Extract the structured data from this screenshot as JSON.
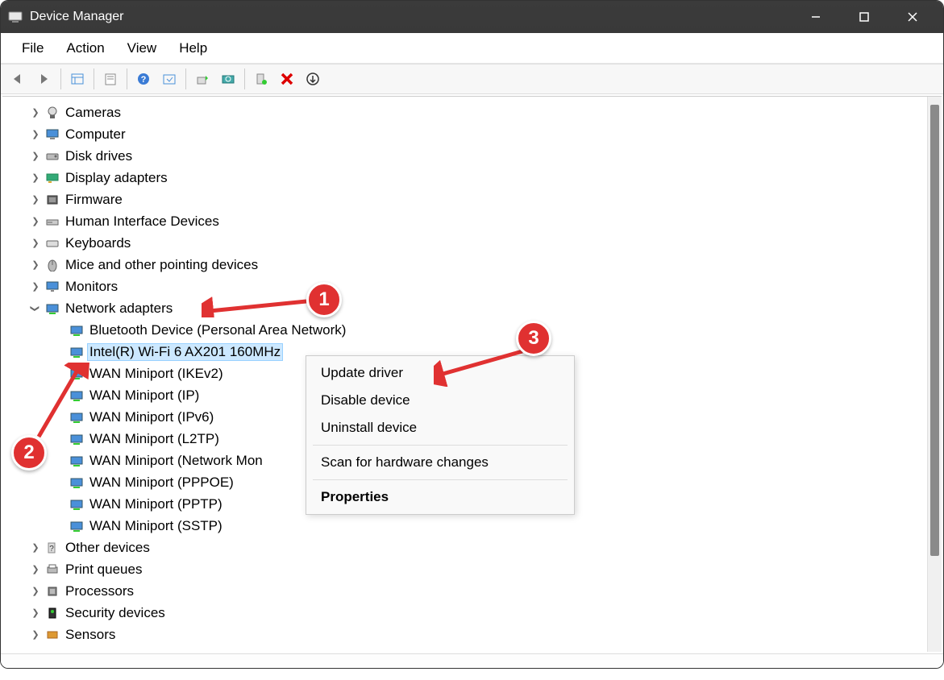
{
  "window": {
    "title": "Device Manager"
  },
  "menubar": {
    "file": "File",
    "action": "Action",
    "view": "View",
    "help": "Help"
  },
  "tree": {
    "cameras": "Cameras",
    "computer": "Computer",
    "disk_drives": "Disk drives",
    "display_adapters": "Display adapters",
    "firmware": "Firmware",
    "hid": "Human Interface Devices",
    "keyboards": "Keyboards",
    "mice": "Mice and other pointing devices",
    "monitors": "Monitors",
    "network_adapters": "Network adapters",
    "net_children": {
      "bt": "Bluetooth Device (Personal Area Network)",
      "wifi": "Intel(R) Wi-Fi 6 AX201 160MHz",
      "wan_ikev2": "WAN Miniport (IKEv2)",
      "wan_ip": "WAN Miniport (IP)",
      "wan_ipv6": "WAN Miniport (IPv6)",
      "wan_l2tp": "WAN Miniport (L2TP)",
      "wan_netmon": "WAN Miniport (Network Mon",
      "wan_pppoe": "WAN Miniport (PPPOE)",
      "wan_pptp": "WAN Miniport (PPTP)",
      "wan_sstp": "WAN Miniport (SSTP)"
    },
    "other_devices": "Other devices",
    "print_queues": "Print queues",
    "processors": "Processors",
    "security_devices": "Security devices",
    "sensors": "Sensors"
  },
  "context_menu": {
    "update_driver": "Update driver",
    "disable_device": "Disable device",
    "uninstall_device": "Uninstall device",
    "scan_hardware": "Scan for hardware changes",
    "properties": "Properties"
  },
  "annotations": {
    "b1": "1",
    "b2": "2",
    "b3": "3"
  }
}
